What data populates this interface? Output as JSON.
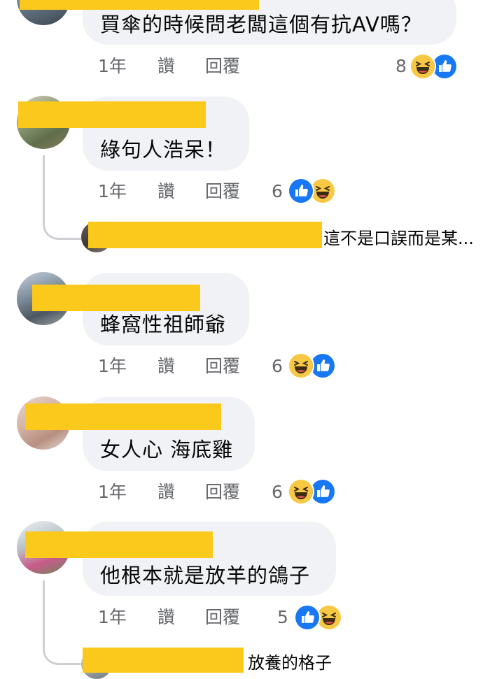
{
  "colors": {
    "redaction": "#fbc91c",
    "bubble": "#f0f2f5",
    "meta": "#65676b",
    "like": "#1877f2",
    "haha": "#f7c843"
  },
  "comments": [
    {
      "text": "買傘的時候問老闆這個有抗AV嗎？",
      "time": "1年",
      "like_label": "讚",
      "reply_label": "回覆",
      "reaction_count": "8",
      "reactions": [
        "haha-icon",
        "like-icon"
      ]
    },
    {
      "text": "綠句人浩呆！",
      "time": "1年",
      "like_label": "讚",
      "reply_label": "回覆",
      "reaction_count": "6",
      "reactions": [
        "like-icon",
        "haha-icon"
      ]
    },
    {
      "text": "蜂窩性祖師爺",
      "time": "1年",
      "like_label": "讚",
      "reply_label": "回覆",
      "reaction_count": "6",
      "reactions": [
        "haha-icon",
        "like-icon"
      ]
    },
    {
      "text": "女人心 海底雞",
      "time": "1年",
      "like_label": "讚",
      "reply_label": "回覆",
      "reaction_count": "6",
      "reactions": [
        "haha-icon",
        "like-icon"
      ]
    },
    {
      "text": "他根本就是放羊的鴿子",
      "time": "1年",
      "like_label": "讚",
      "reply_label": "回覆",
      "reaction_count": "5",
      "reactions": [
        "like-icon",
        "haha-icon"
      ]
    }
  ],
  "replies": [
    {
      "preview": "這不是口誤而是某..."
    },
    {
      "preview": "放養的格子"
    }
  ]
}
